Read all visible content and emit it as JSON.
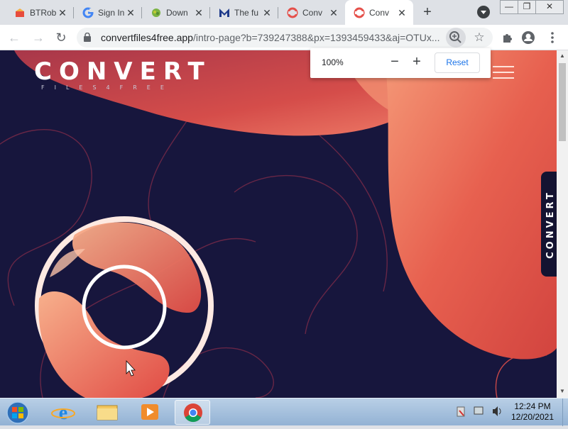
{
  "tabs": [
    {
      "title": "BTRob",
      "icon": "btrobux-icon"
    },
    {
      "title": "Sign In",
      "icon": "google-icon"
    },
    {
      "title": "Down",
      "icon": "download-site-icon"
    },
    {
      "title": "The fu",
      "icon": "m-logo-icon"
    },
    {
      "title": "Conv",
      "icon": "convert-icon"
    },
    {
      "title": "Conv",
      "icon": "convert-icon",
      "active": true
    }
  ],
  "newtab_label": "+",
  "window_controls": {
    "minimize": "—",
    "restore": "❐",
    "close": "✕"
  },
  "omnibox": {
    "host": "convertfiles4free.app",
    "path": "/intro-page?b=739247388&px=1393459433&aj=OTUx..."
  },
  "zoom_popup": {
    "level": "100%",
    "minus": "−",
    "plus": "+",
    "reset": "Reset"
  },
  "page": {
    "logo_text": "CONVERT",
    "logo_subtext": "FILES4FREE",
    "side_tab_text": "CONVERT"
  },
  "colors": {
    "page_bg": "#17163d",
    "accent_coral": "#e5504a",
    "accent_peach": "#f39a7a",
    "chrome_tabstrip": "#dee1e6",
    "link_blue": "#1a73e8"
  },
  "taskbar": {
    "apps": [
      "windows-explorer-icon",
      "internet-explorer-icon",
      "file-explorer-icon",
      "media-player-icon",
      "chrome-icon"
    ],
    "clock_time": "12:24 PM",
    "clock_date": "12/20/2021"
  }
}
